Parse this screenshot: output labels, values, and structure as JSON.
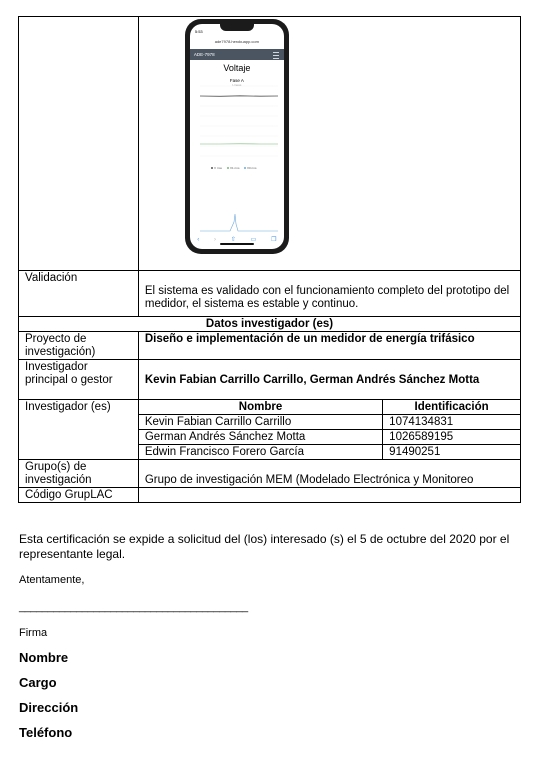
{
  "phone": {
    "status_time": "5:53",
    "url": "ade7978.herokuapp.com",
    "app_title": "ADE-7978",
    "chart_title": "Voltaje",
    "chart_subtitle": "Fase A",
    "chart_caption": "Líneas",
    "legend": [
      "V rms",
      "V1 rms",
      "V0 rms"
    ],
    "series_colors": [
      "#555555",
      "#7ab67a",
      "#6fa8dc"
    ]
  },
  "validacion": {
    "label": "Validación",
    "text": "El sistema es validado con el funcionamiento completo del prototipo del medidor, el sistema es estable y continuo."
  },
  "datos_header": "Datos investigador (es)",
  "proyecto": {
    "label": "Proyecto de investigación)",
    "value": "Diseño e implementación de un medidor de energía trifásico"
  },
  "investigador_principal": {
    "label": "Investigador principal o gestor",
    "value": "Kevin Fabian Carrillo Carrillo, German Andrés Sánchez Motta"
  },
  "investigadores": {
    "label": "Investigador (es)",
    "col_nombre": "Nombre",
    "col_id": "Identificación",
    "rows": [
      {
        "nombre": "Kevin Fabian Carrillo Carrillo",
        "id": "1074134831"
      },
      {
        "nombre": "German Andrés Sánchez Motta",
        "id": "1026589195"
      },
      {
        "nombre": "Edwin Francisco Forero García",
        "id": "91490251"
      }
    ]
  },
  "grupo": {
    "label": "Grupo(s) de investigación",
    "value": "Grupo de investigación MEM (Modelado Electrónica y Monitoreo"
  },
  "codigo": {
    "label": "Código GrupLAC",
    "value": ""
  },
  "certificacion": "Esta certificación se expide a solicitud del (los) interesado (s) el 5 de octubre del 2020 por el representante legal.",
  "atentamente": "Atentamente,",
  "firma_line": "________________________________________",
  "firma": "Firma",
  "nombre": "Nombre",
  "cargo": "Cargo",
  "direccion": "Dirección",
  "telefono": "Teléfono"
}
